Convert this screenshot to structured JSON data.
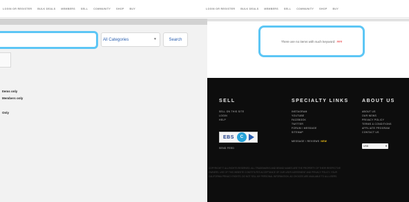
{
  "nav": {
    "left_items": [
      "LOGIN OR REGISTER",
      "BULK DEALS",
      "MEMBERS",
      "SELL",
      "COMMUNITY",
      "SHOP",
      "BUY"
    ],
    "right_items": [
      "LOGIN OR REGISTER",
      "BULK DEALS",
      "MEMBERS",
      "SELL",
      "COMMUNITY",
      "SHOP",
      "BUY"
    ]
  },
  "search": {
    "value": "",
    "category_selected": "All Categories",
    "button_label": "Search"
  },
  "filters": [
    "Items only",
    "Members only",
    "Only"
  ],
  "message": {
    "text": "There are no items with such keyword:",
    "highlight": "###"
  },
  "footer": {
    "sell": {
      "title": "SELL",
      "links": [
        "SELL ON THIS SITE",
        "LOGIN",
        "HELP"
      ],
      "badge_text": "EBS",
      "badge_mark": "C",
      "extra_link": "SEND FEED"
    },
    "specialty": {
      "title": "SPECIALTY LINKS",
      "links": [
        "INSTAGRAM",
        "YOUTUBE",
        "FACEBOOK",
        "TWITTER",
        "FORUM / MESSAGE",
        "SITEMAP",
        "MESSAGE / REVIEWS"
      ],
      "new_label": "NEW"
    },
    "about": {
      "title": "ABOUT US",
      "links": [
        "ABOUT US",
        "OUR NEWS",
        "PRIVACY POLICY",
        "TERMS & CONDITIONS",
        "AFFILIATE PROGRAM",
        "CONTACT US"
      ],
      "currency": "USD"
    },
    "legal_lines": [
      "COPYRIGHT © ALL RIGHTS RESERVED. ALL TRADEMARKS AND BRAND NAMES ARE THE PROPERTY OF THEIR RESPECTIVE",
      "OWNERS. USE OF THIS WEBSITE CONSTITUTES ACCEPTANCE OF OUR USER AGREEMENT AND PRIVACY POLICY. YOUR",
      "CALIFORNIA PRIVACY RIGHTS. DO NOT SELL MY PERSONAL INFORMATION. AD CHOICES ARE AVAILABLE TO ALL USERS."
    ]
  },
  "colors": {
    "accent_border": "#5cc6f5",
    "link_blue": "#2a5fb0",
    "error_red": "#e8262a",
    "footer_bg": "#0d0d0d",
    "highlight": "#f5c518"
  }
}
